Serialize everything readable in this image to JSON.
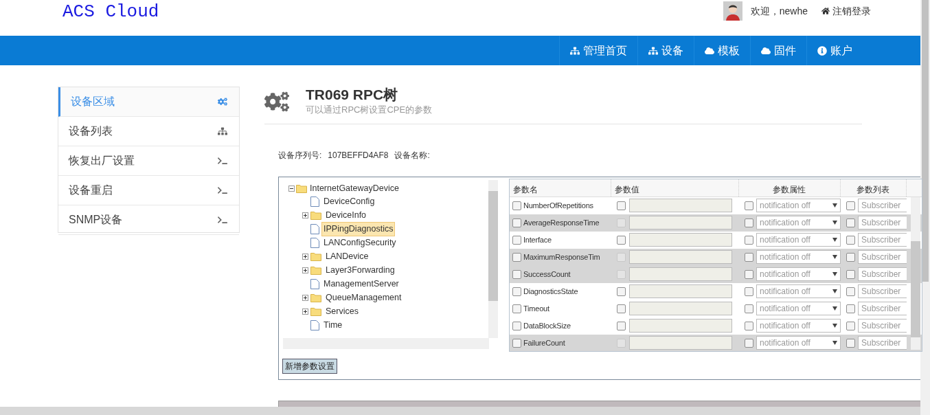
{
  "brand": "ACS Cloud",
  "user": {
    "greeting": "欢迎，newhe",
    "logout": "注销登录"
  },
  "nav": [
    {
      "label": "管理首页"
    },
    {
      "label": "设备"
    },
    {
      "label": "模板"
    },
    {
      "label": "固件"
    },
    {
      "label": "账户"
    }
  ],
  "sidebar": {
    "items": [
      {
        "label": "设备区域",
        "selected": true
      },
      {
        "label": "设备列表",
        "selected": false
      },
      {
        "label": "恢复出厂设置",
        "selected": false
      },
      {
        "label": "设备重启",
        "selected": false
      },
      {
        "label": "SNMP设备",
        "selected": false
      }
    ]
  },
  "page": {
    "title": "TR069 RPC树",
    "subtitle": "可以通过RPC树设置CPE的参数"
  },
  "device": {
    "serial_label": "设备序列号:",
    "serial": "107BEFFD4AF8",
    "name_label": "设备名称:"
  },
  "tree": {
    "label": "InternetGatewayDevice",
    "expanded": true,
    "children": [
      {
        "label": "DeviceConfig",
        "kind": "leaf",
        "selected": false
      },
      {
        "label": "DeviceInfo",
        "kind": "folder",
        "selected": false
      },
      {
        "label": "IPPingDiagnostics",
        "kind": "leaf",
        "selected": true
      },
      {
        "label": "LANConfigSecurity",
        "kind": "leaf",
        "selected": false
      },
      {
        "label": "LANDevice",
        "kind": "folder",
        "selected": false
      },
      {
        "label": "Layer3Forwarding",
        "kind": "folder",
        "selected": false
      },
      {
        "label": "ManagementServer",
        "kind": "leaf",
        "selected": false
      },
      {
        "label": "QueueManagement",
        "kind": "folder",
        "selected": false
      },
      {
        "label": "Services",
        "kind": "folder",
        "selected": false
      },
      {
        "label": "Time",
        "kind": "leaf",
        "selected": false
      }
    ]
  },
  "add_button": "新增参数设置",
  "table": {
    "columns": [
      "参数名",
      "参数值",
      "参数属性",
      "参数列表"
    ],
    "rows": [
      {
        "name": "NumberOfRepetitions",
        "readonly": false,
        "notification": "notification off",
        "access": "Subscriber"
      },
      {
        "name": "AverageResponseTime",
        "readonly": true,
        "notification": "notification off",
        "access": "Subscriber"
      },
      {
        "name": "Interface",
        "readonly": false,
        "notification": "notification off",
        "access": "Subscriber"
      },
      {
        "name": "MaximumResponseTim",
        "readonly": true,
        "notification": "notification off",
        "access": "Subscriber"
      },
      {
        "name": "SuccessCount",
        "readonly": true,
        "notification": "notification off",
        "access": "Subscriber"
      },
      {
        "name": "DiagnosticsState",
        "readonly": false,
        "notification": "notification off",
        "access": "Subscriber"
      },
      {
        "name": "Timeout",
        "readonly": false,
        "notification": "notification off",
        "access": "Subscriber"
      },
      {
        "name": "DataBlockSize",
        "readonly": false,
        "notification": "notification off",
        "access": "Subscriber"
      },
      {
        "name": "FailureCount",
        "readonly": true,
        "notification": "notification off",
        "access": "Subscriber"
      }
    ]
  }
}
